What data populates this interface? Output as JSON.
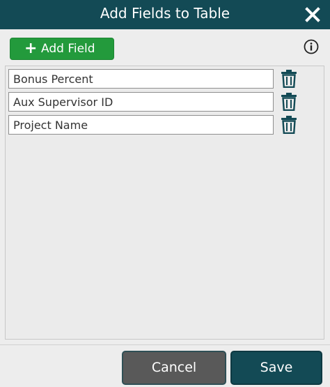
{
  "dialog": {
    "title": "Add Fields to Table",
    "close_icon": "close-icon"
  },
  "toolbar": {
    "add_field_label": "Add Field",
    "add_icon": "plus-icon",
    "info_icon": "info-icon"
  },
  "fields": [
    {
      "value": "Bonus Percent",
      "delete_icon": "trash-icon"
    },
    {
      "value": "Aux Supervisor ID",
      "delete_icon": "trash-icon"
    },
    {
      "value": "Project Name",
      "delete_icon": "trash-icon"
    }
  ],
  "footer": {
    "cancel_label": "Cancel",
    "save_label": "Save"
  },
  "colors": {
    "header": "#134a55",
    "add_button": "#239a3c",
    "cancel_button": "#595959",
    "save_button": "#134a55",
    "icon": "#134a55"
  }
}
